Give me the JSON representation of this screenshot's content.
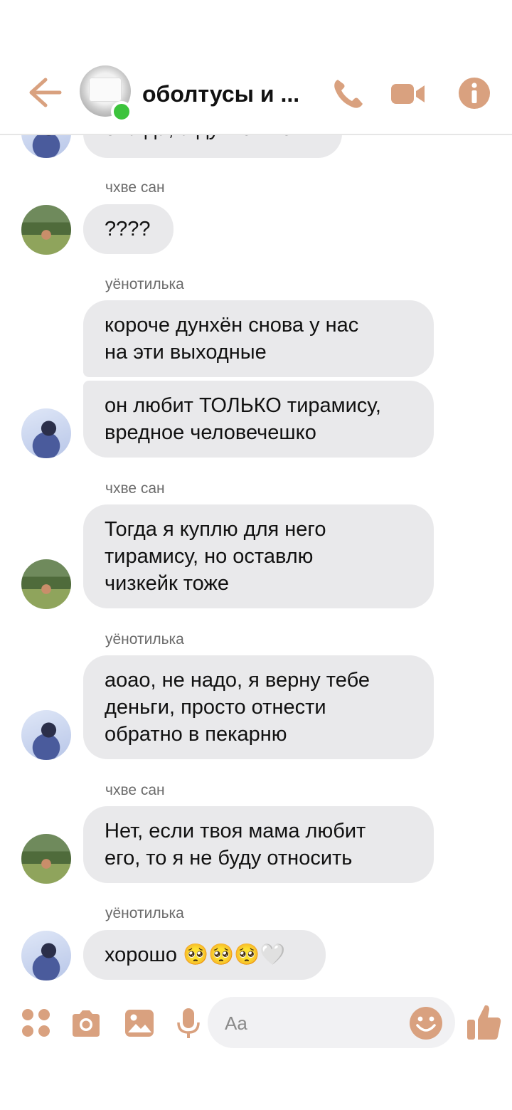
{
  "header": {
    "title": "оболтусы и ...",
    "online": true
  },
  "colors": {
    "accent": "#d9a17f",
    "bubble": "#e9e9eb",
    "online": "#3cc33c"
  },
  "messages": [
    {
      "sender": "",
      "avatar": "person-a",
      "text": "она да, а дунхён нет"
    },
    {
      "sender": "чхве сан",
      "avatar": "person-b",
      "text": "????"
    },
    {
      "sender": "уёнотилька",
      "avatar": "",
      "text": "короче дунхён снова у нас\nна эти выходные"
    },
    {
      "sender": "",
      "avatar": "person-a",
      "text": "он любит ТОЛЬКО тирамису,\nвредное человечешко"
    },
    {
      "sender": "чхве сан",
      "avatar": "person-b",
      "text": "Тогда я куплю для него\nтирамису, но оставлю\nчизкейк тоже"
    },
    {
      "sender": "уёнотилька",
      "avatar": "person-a",
      "text": "аоао, не надо, я верну тебе\nденьги, просто отнести\nобратно в пекарню"
    },
    {
      "sender": "чхве сан",
      "avatar": "person-b",
      "text": "Нет, если твоя мама любит\nего, то я не буду относить"
    },
    {
      "sender": "уёнотилька",
      "avatar": "person-a",
      "text": "хорошо 🥺🥺🥺🤍"
    }
  ],
  "composer": {
    "placeholder": "Aa",
    "icons": [
      "more-apps-icon",
      "camera-icon",
      "gallery-icon",
      "microphone-icon",
      "emoji-icon",
      "thumbs-up-icon"
    ]
  }
}
